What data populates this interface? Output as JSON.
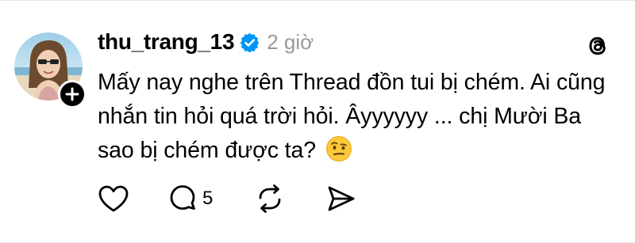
{
  "post": {
    "username": "thu_trang_13",
    "time": "2 giờ",
    "text": "Mấy nay nghe trên Thread đồn tui bị chém. Ai cũng nhắn tin hỏi quá trời hỏi. Âyyyyyy ... chị Mười Ba sao bị chém được ta?",
    "emoji": "🤨"
  },
  "actions": {
    "reply_count": "5"
  },
  "icons": {
    "verified": "verified-badge-icon",
    "threads": "threads-logo-icon",
    "like": "heart-icon",
    "reply": "comment-icon",
    "repost": "repost-icon",
    "share": "send-icon",
    "follow": "plus-icon"
  },
  "colors": {
    "verified_blue": "#0095f6",
    "secondary_text": "#999999"
  }
}
